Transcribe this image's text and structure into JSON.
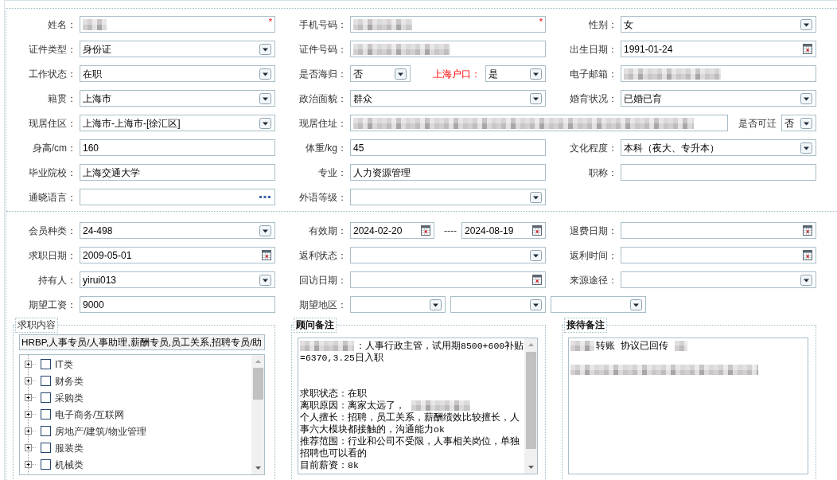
{
  "basic_info": {
    "rows": [
      [
        {
          "label": "姓名：",
          "controls": [
            {
              "kind": "text",
              "redacted": true,
              "required_mark": "*"
            }
          ]
        },
        {
          "label": "手机号码：",
          "controls": [
            {
              "kind": "text",
              "redacted": true,
              "required_mark": "*"
            }
          ]
        },
        {
          "label": "性别：",
          "controls": [
            {
              "kind": "select",
              "value": "女"
            }
          ]
        }
      ],
      [
        {
          "label": "证件类型：",
          "controls": [
            {
              "kind": "select",
              "value": "身份证"
            }
          ]
        },
        {
          "label": "证件号码：",
          "controls": [
            {
              "kind": "text",
              "redacted": true
            }
          ]
        },
        {
          "label": "出生日期：",
          "controls": [
            {
              "kind": "date",
              "value": "1991-01-24"
            }
          ]
        }
      ],
      [
        {
          "label": "工作状态：",
          "controls": [
            {
              "kind": "select",
              "value": "在职"
            }
          ]
        },
        {
          "label": "是否海归：",
          "controls": [
            {
              "kind": "select",
              "value": "否"
            },
            {
              "kind": "label",
              "text": "上海户口：",
              "highlight": true
            },
            {
              "kind": "select",
              "value": "是"
            }
          ]
        },
        {
          "label": "电子邮箱：",
          "controls": [
            {
              "kind": "text",
              "redacted": true
            }
          ]
        }
      ],
      [
        {
          "label": "籍贯：",
          "controls": [
            {
              "kind": "select",
              "value": "上海市"
            }
          ]
        },
        {
          "label": "政治面貌：",
          "controls": [
            {
              "kind": "select",
              "value": "群众"
            }
          ]
        },
        {
          "label": "婚育状况：",
          "controls": [
            {
              "kind": "select",
              "value": "已婚已育"
            }
          ]
        }
      ],
      [
        {
          "label": "现居住区：",
          "controls": [
            {
              "kind": "select",
              "value": "上海市-上海市-[徐汇区]"
            }
          ]
        },
        {
          "label": "现居住址：",
          "controls": [
            {
              "kind": "long-text",
              "redacted": true
            },
            {
              "kind": "label",
              "text": "是否可迁",
              "highlight": false
            },
            {
              "kind": "select",
              "value": "否"
            }
          ]
        }
      ],
      [
        {
          "label": "身高/cm：",
          "controls": [
            {
              "kind": "text",
              "value": "160"
            }
          ]
        },
        {
          "label": "体重/kg：",
          "controls": [
            {
              "kind": "text",
              "value": "45"
            }
          ]
        },
        {
          "label": "文化程度：",
          "controls": [
            {
              "kind": "select",
              "value": "本科（夜大、专升本）"
            }
          ]
        }
      ],
      [
        {
          "label": "毕业院校：",
          "controls": [
            {
              "kind": "text",
              "value": "上海交通大学"
            }
          ]
        },
        {
          "label": "专业：",
          "controls": [
            {
              "kind": "text",
              "value": "人力资源管理"
            }
          ]
        },
        {
          "label": "职称：",
          "controls": [
            {
              "kind": "text"
            }
          ]
        }
      ],
      [
        {
          "label": "通晓语言：",
          "controls": [
            {
              "kind": "picker"
            }
          ]
        },
        {
          "label": "外语等级：",
          "controls": [
            {
              "kind": "select"
            }
          ]
        }
      ]
    ]
  },
  "membership": {
    "rows": [
      [
        {
          "label": "会员种类：",
          "controls": [
            {
              "kind": "select",
              "value": "24-498"
            }
          ]
        },
        {
          "label": "有效期：",
          "controls": [
            {
              "kind": "date",
              "value": "2024-02-20"
            },
            {
              "kind": "label",
              "text": "----",
              "highlight": false
            },
            {
              "kind": "date",
              "value": "2024-08-19"
            }
          ]
        },
        {
          "label": "退费日期：",
          "controls": [
            {
              "kind": "date"
            }
          ]
        }
      ],
      [
        {
          "label": "求职日期：",
          "controls": [
            {
              "kind": "date",
              "value": "2009-05-01"
            }
          ]
        },
        {
          "label": "返利状态：",
          "controls": [
            {
              "kind": "select"
            }
          ]
        },
        {
          "label": "返利时间：",
          "controls": [
            {
              "kind": "date"
            }
          ]
        }
      ],
      [
        {
          "label": "持有人：",
          "controls": [
            {
              "kind": "select",
              "value": "yirui013"
            }
          ]
        },
        {
          "label": "回访日期：",
          "controls": [
            {
              "kind": "date"
            }
          ]
        },
        {
          "label": "来源途径：",
          "controls": [
            {
              "kind": "select"
            }
          ]
        }
      ],
      [
        {
          "label": "期望工资：",
          "controls": [
            {
              "kind": "text",
              "value": "9000"
            }
          ]
        },
        {
          "label": "期望地区：",
          "controls": [
            {
              "kind": "select"
            },
            {
              "kind": "select"
            },
            {
              "kind": "select"
            }
          ]
        }
      ]
    ]
  },
  "panels": [
    {
      "kind": "tree",
      "legend": "求职内容",
      "summary": "HRBP,人事专员/人事助理,薪酬专员,员工关系,招聘专员/助",
      "scrollable": true,
      "items": [
        {
          "label": "IT类",
          "expanded": false,
          "checked": false
        },
        {
          "label": "财务类",
          "expanded": false,
          "checked": false
        },
        {
          "label": "采购类",
          "expanded": false,
          "checked": false
        },
        {
          "label": "电子商务/互联网",
          "expanded": false,
          "checked": false
        },
        {
          "label": "房地产/建筑/物业管理",
          "expanded": false,
          "checked": false
        },
        {
          "label": "服装类",
          "expanded": false,
          "checked": false
        },
        {
          "label": "机械类",
          "expanded": false,
          "checked": false
        }
      ]
    },
    {
      "kind": "notes",
      "legend": "顾问备注",
      "scrollable": true,
      "lines": [
        {
          "kind": "text",
          "parts": [
            {
              "kind": "redacted"
            },
            {
              "kind": "text",
              "text": "：人事行政主管，试用期8500+600补贴"
            }
          ]
        },
        {
          "kind": "text",
          "parts": [
            {
              "kind": "text",
              "text": "=6370,3.25日入职"
            }
          ]
        },
        {
          "kind": "blank"
        },
        {
          "kind": "blank"
        },
        {
          "kind": "text",
          "parts": [
            {
              "kind": "text",
              "text": "求职状态：在职"
            }
          ]
        },
        {
          "kind": "text",
          "parts": [
            {
              "kind": "text",
              "text": "离职原因：离家太远了，"
            },
            {
              "kind": "redacted"
            }
          ]
        },
        {
          "kind": "text",
          "parts": [
            {
              "kind": "text",
              "text": "个人擅长：招聘，员工关系，薪酬绩效比较擅长，人"
            }
          ]
        },
        {
          "kind": "text",
          "parts": [
            {
              "kind": "text",
              "text": "事六大模块都接触的，沟通能力ok"
            }
          ]
        },
        {
          "kind": "text",
          "parts": [
            {
              "kind": "text",
              "text": "推荐范围：行业和公司不受限，人事相关岗位，单独"
            }
          ]
        },
        {
          "kind": "text",
          "parts": [
            {
              "kind": "text",
              "text": "招聘也可以看的"
            }
          ]
        },
        {
          "kind": "text",
          "parts": [
            {
              "kind": "text",
              "text": "目前薪资：8k"
            }
          ]
        }
      ]
    },
    {
      "kind": "notes",
      "legend": "接待备注",
      "scrollable": false,
      "lines": [
        {
          "kind": "text",
          "parts": [
            {
              "kind": "redacted"
            },
            {
              "kind": "text",
              "text": "转账 协议已回传"
            },
            {
              "kind": "redacted"
            }
          ]
        },
        {
          "kind": "blank"
        },
        {
          "kind": "text",
          "parts": [
            {
              "kind": "redacted"
            }
          ]
        }
      ]
    }
  ]
}
